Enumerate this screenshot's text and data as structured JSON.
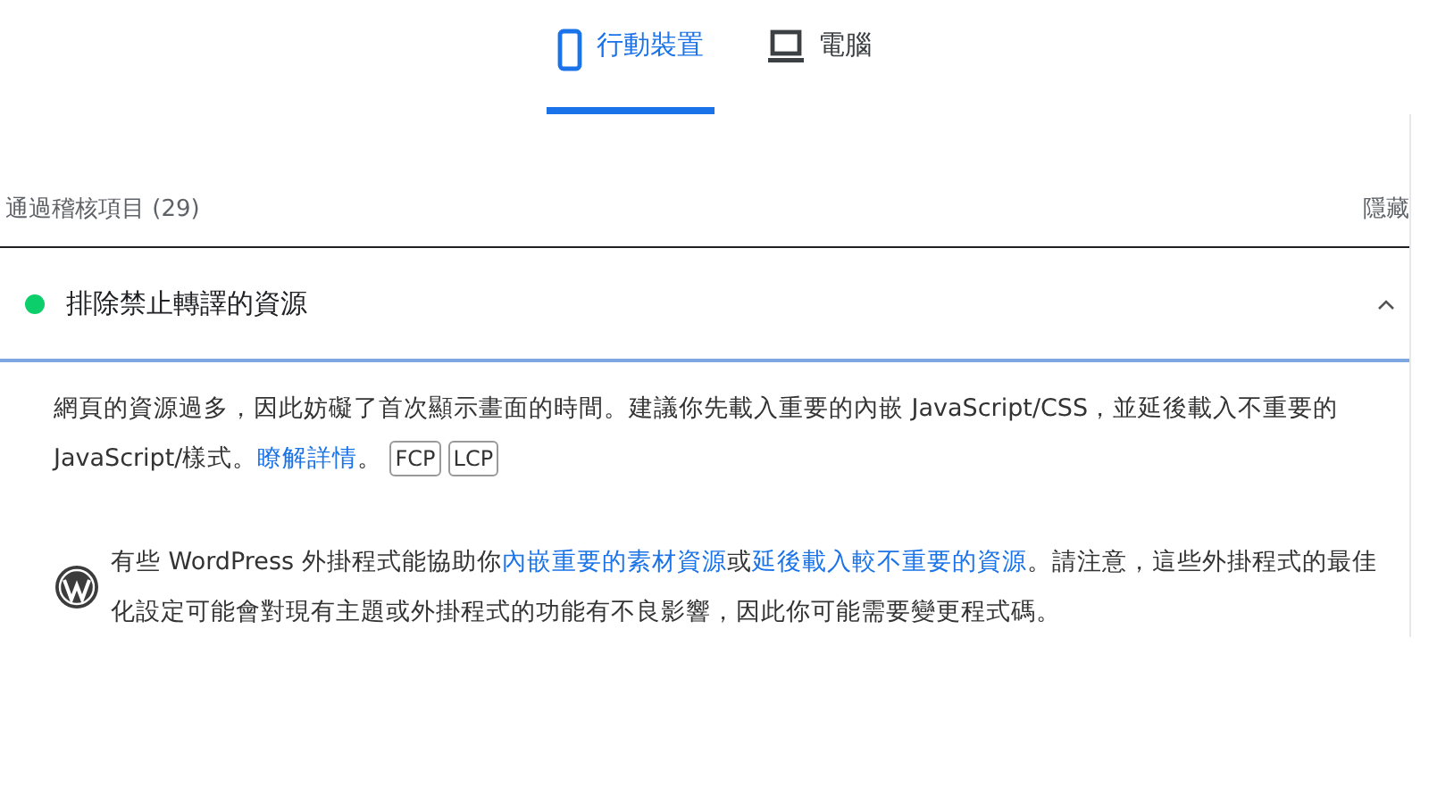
{
  "tabs": [
    {
      "label": "行動裝置",
      "kind": "phone",
      "selected": true
    },
    {
      "label": "電腦",
      "kind": "desktop",
      "selected": false
    }
  ],
  "passed_header": {
    "title": "通過稽核項目 (29)",
    "action": "隱藏"
  },
  "audit": {
    "title": "排除禁止轉譯的資源",
    "color": "#0cce6b",
    "expanded": true,
    "description": [
      {
        "kind": "text",
        "text": "網頁的資源過多，因此妨礙了首次顯示畫面的時間。建議你先載入重要的內嵌 JavaScript/CSS，並延後載入不重要的 JavaScript/樣式。"
      },
      {
        "kind": "link",
        "text": "瞭解詳情"
      },
      {
        "kind": "text",
        "text": "。"
      },
      {
        "kind": "badge",
        "text": "FCP"
      },
      {
        "kind": "badge",
        "text": "LCP"
      }
    ],
    "note": [
      {
        "kind": "text",
        "text": "有些 WordPress 外掛程式能協助你"
      },
      {
        "kind": "link",
        "text": "內嵌重要的素材資源"
      },
      {
        "kind": "text",
        "text": "或"
      },
      {
        "kind": "link",
        "text": "延後載入較不重要的資源"
      },
      {
        "kind": "text",
        "text": "。請注意，這些外掛程式的最佳化設定可能會對現有主題或外掛程式的功能有不良影響，因此你可能需要變更程式碼。"
      }
    ]
  }
}
